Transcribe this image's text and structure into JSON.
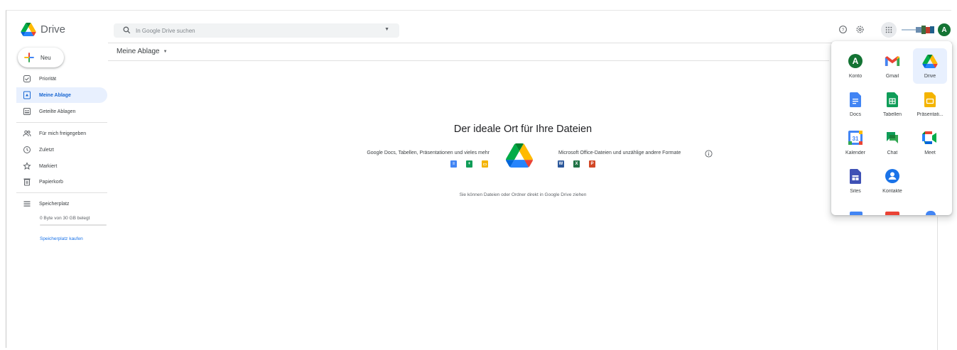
{
  "header": {
    "app_name": "Drive",
    "search_placeholder": "In Google Drive suchen",
    "avatar_initial": "A"
  },
  "sidebar": {
    "new_label": "Neu",
    "items": [
      {
        "label": "Priorität",
        "icon": "check-circle-icon"
      },
      {
        "label": "Meine Ablage",
        "icon": "my-drive-icon",
        "active": true
      },
      {
        "label": "Geteilte Ablagen",
        "icon": "shared-drives-icon"
      },
      {
        "label": "Für mich freigegeben",
        "icon": "shared-with-me-icon"
      },
      {
        "label": "Zuletzt",
        "icon": "clock-icon"
      },
      {
        "label": "Markiert",
        "icon": "star-icon"
      },
      {
        "label": "Papierkorb",
        "icon": "trash-icon"
      },
      {
        "label": "Speicherplatz",
        "icon": "storage-icon"
      }
    ],
    "storage_usage": "0 Byte von 30 GB belegt",
    "storage_fraction": 0.0,
    "buy_storage": "Speicherplatz kaufen"
  },
  "main": {
    "folder_title": "Meine Ablage",
    "empty_title": "Der ideale Ort für Ihre Dateien",
    "google_files_text": "Google Docs, Tabellen, Präsentationen und vieles mehr",
    "office_files_text": "Microsoft Office-Dateien und unzählige andere Formate",
    "drag_hint": "Sie können Dateien oder Ordner direkt in Google Drive ziehen",
    "office_letters": [
      "W",
      "X",
      "P"
    ]
  },
  "apps_panel": {
    "apps": [
      {
        "label": "Konto",
        "icon": "account-icon",
        "letter": "A"
      },
      {
        "label": "Gmail",
        "icon": "gmail-icon"
      },
      {
        "label": "Drive",
        "icon": "drive-icon",
        "selected": true
      },
      {
        "label": "Docs",
        "icon": "docs-icon"
      },
      {
        "label": "Tabellen",
        "icon": "sheets-icon"
      },
      {
        "label": "Präsentati...",
        "icon": "slides-icon"
      },
      {
        "label": "Kalender",
        "icon": "calendar-icon",
        "day": "31"
      },
      {
        "label": "Chat",
        "icon": "chat-icon"
      },
      {
        "label": "Meet",
        "icon": "meet-icon"
      },
      {
        "label": "Sites",
        "icon": "sites-icon"
      },
      {
        "label": "Kontakte",
        "icon": "contacts-icon"
      }
    ]
  },
  "colors": {
    "accent_blue": "#1a73e8",
    "active_bg": "#e8f0fe",
    "docs_blue": "#4285f4",
    "sheets_green": "#0f9d58",
    "slides_yellow": "#f4b400",
    "word_blue": "#2b579a",
    "excel_green": "#217346",
    "ppt_orange": "#d24726",
    "avatar_green": "#137333"
  }
}
